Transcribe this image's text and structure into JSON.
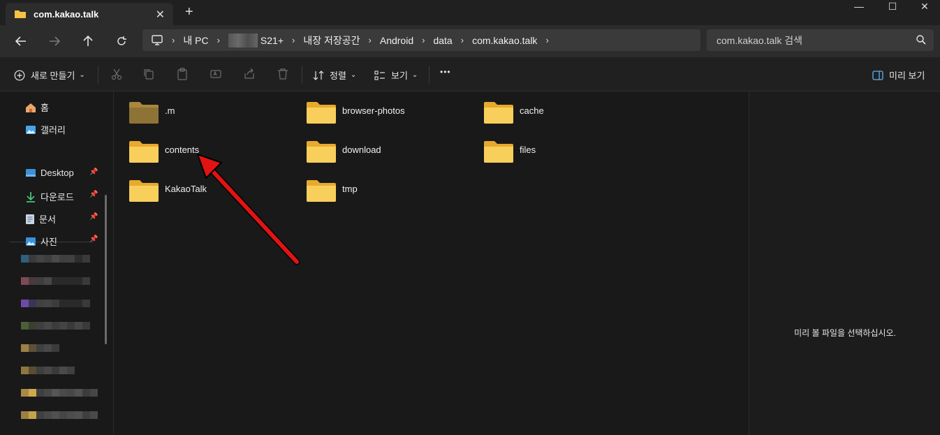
{
  "tab": {
    "title": "com.kakao.talk",
    "close": "✕",
    "new": "+"
  },
  "window_controls": {
    "minimize": "—",
    "maximize": "☐",
    "close": "✕"
  },
  "breadcrumb": {
    "items": [
      "내 PC",
      "S21+",
      "내장 저장공간",
      "Android",
      "data",
      "com.kakao.talk"
    ]
  },
  "search": {
    "placeholder": "com.kakao.talk 검색"
  },
  "toolbar": {
    "new_label": "새로 만들기",
    "sort_label": "정렬",
    "view_label": "보기",
    "more": "•••",
    "preview_label": "미리 보기"
  },
  "sidebar": {
    "home": "홈",
    "gallery": "갤러리",
    "desktop": "Desktop",
    "downloads": "다운로드",
    "documents": "문서",
    "pictures": "사진"
  },
  "folders": [
    ".m",
    "browser-photos",
    "cache",
    "contents",
    "download",
    "files",
    "KakaoTalk",
    "tmp"
  ],
  "preview": {
    "empty_text": "미리 볼 파일을 선택하십시오."
  },
  "colors": {
    "folder": "#f6c244",
    "folder_dim": "#a9883c",
    "arrow": "#e11313"
  }
}
